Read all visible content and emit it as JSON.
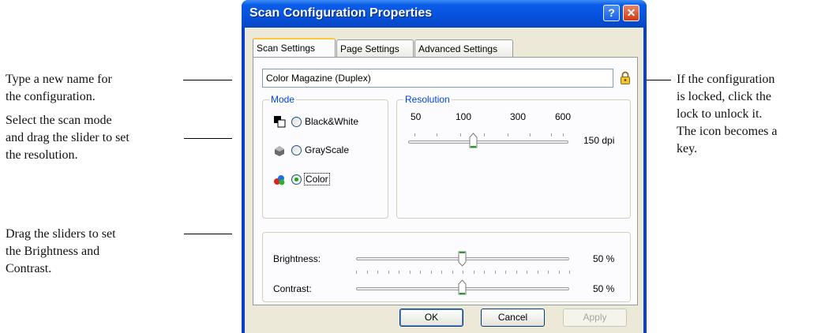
{
  "callouts": {
    "name_line1": "Type a new name for",
    "name_line2": "the configuration.",
    "mode_line1": "Select the scan mode",
    "mode_line2": "and drag the slider to set",
    "mode_line3": "the resolution.",
    "sliders_line1": "Drag the sliders to set",
    "sliders_line2": "the Brightness and",
    "sliders_line3": "Contrast.",
    "lock_line1": "If the configuration",
    "lock_line2": "is locked, click the",
    "lock_line3": "lock to unlock it.",
    "lock_line4": "The icon becomes a",
    "lock_line5": "key."
  },
  "dialog": {
    "title": "Scan Configuration Properties",
    "help_label": "?",
    "close_label": "✕",
    "tabs": [
      {
        "label": "Scan Settings"
      },
      {
        "label": "Page Settings"
      },
      {
        "label": "Advanced Settings"
      }
    ],
    "config_name": "Color Magazine (Duplex)",
    "lock_icon": "lock-icon",
    "mode": {
      "label": "Mode",
      "options": [
        {
          "label": "Black&White",
          "icon": "bw-mode-icon",
          "selected": false
        },
        {
          "label": "GrayScale",
          "icon": "grayscale-mode-icon",
          "selected": false
        },
        {
          "label": "Color",
          "icon": "color-mode-icon",
          "selected": true
        }
      ]
    },
    "resolution": {
      "label": "Resolution",
      "ticks": [
        "50",
        "100",
        "300",
        "600"
      ],
      "value_label": "150 dpi",
      "value_dpi": 150
    },
    "brightness": {
      "label": "Brightness:",
      "value_label": "50 %",
      "value": 50
    },
    "contrast": {
      "label": "Contrast:",
      "value_label": "50 %",
      "value": 50
    },
    "buttons": {
      "ok": "OK",
      "cancel": "Cancel",
      "apply": "Apply"
    }
  },
  "colors": {
    "titlebar": "#0652dc",
    "group_label": "#0046d5",
    "dialog_face": "#ece9d8",
    "tab_highlight": "#ffc83c"
  }
}
